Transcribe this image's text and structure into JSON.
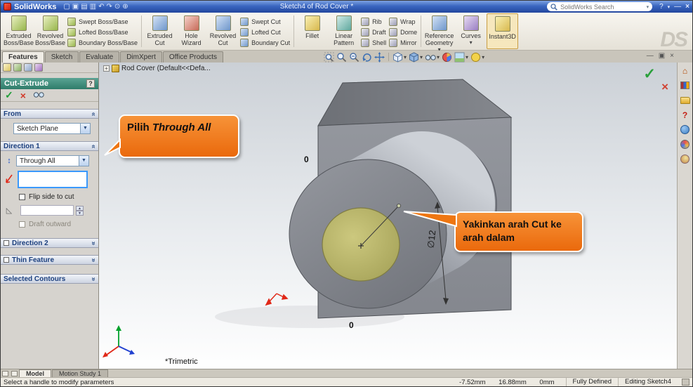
{
  "icons": {
    "new": "▢",
    "open": "▣",
    "save": "▤",
    "print": "▥",
    "undo": "↶",
    "redo": "↷",
    "rebuild": "⊙",
    "options": "⊕",
    "dropdown": "▾",
    "minimize": "—",
    "close": "×",
    "confirm": "✓",
    "cancel": "×",
    "select_arrow": "▼",
    "spin_up": "▲",
    "spin_down": "▼",
    "chevron": "«",
    "plus": "+"
  },
  "titlebar": {
    "app": "SolidWorks",
    "doc": "Sketch4 of Rod Cover *",
    "search_placeholder": "SolidWorks Search",
    "help": "?"
  },
  "ribbon": {
    "watermark": "DS",
    "g1": {
      "large": [
        {
          "label": "Extruded Boss/Base"
        },
        {
          "label": "Revolved Boss/Base"
        }
      ],
      "small": [
        {
          "label": "Swept Boss/Base"
        },
        {
          "label": "Lofted Boss/Base"
        },
        {
          "label": "Boundary Boss/Base"
        }
      ]
    },
    "g2": {
      "large": [
        {
          "label": "Extruded Cut"
        },
        {
          "label": "Hole Wizard"
        },
        {
          "label": "Revolved Cut"
        }
      ],
      "small": [
        {
          "label": "Swept Cut"
        },
        {
          "label": "Lofted Cut"
        },
        {
          "label": "Boundary Cut"
        }
      ]
    },
    "g3": {
      "large": [
        {
          "label": "Fillet"
        },
        {
          "label": "Linear Pattern"
        }
      ],
      "small": [
        {
          "label": "Rib"
        },
        {
          "label": "Draft"
        },
        {
          "label": "Shell"
        }
      ],
      "small2": [
        {
          "label": "Wrap"
        },
        {
          "label": "Dome"
        },
        {
          "label": "Mirror"
        }
      ]
    },
    "g4": {
      "large": [
        {
          "label": "Reference Geometry"
        },
        {
          "label": "Curves"
        },
        {
          "label": "Instant3D"
        }
      ]
    }
  },
  "tabs": [
    {
      "label": "Features"
    },
    {
      "label": "Sketch"
    },
    {
      "label": "Evaluate"
    },
    {
      "label": "DimXpert"
    },
    {
      "label": "Office Products"
    }
  ],
  "property_manager": {
    "title": "Cut-Extrude",
    "help": "?",
    "from": {
      "header": "From",
      "value": "Sketch Plane"
    },
    "direction1": {
      "header": "Direction 1",
      "end_condition": "Through All",
      "flip_label": "Flip side to cut",
      "draft_outward_label": "Draft outward"
    },
    "direction2": {
      "header": "Direction 2"
    },
    "thin_feature": {
      "header": "Thin Feature"
    },
    "selected_contours": {
      "header": "Selected Contours"
    }
  },
  "viewport": {
    "tree_node": "Rod Cover (Default<<Defa...",
    "view_orientation": "*Trimetric",
    "dimension": "∅12",
    "ordinate_zero_top": "0",
    "ordinate_zero_bottom": "0",
    "callout1": {
      "text": "Pilih ",
      "emphasis": "Through All"
    },
    "callout2": {
      "text": "Yakinkan arah Cut ke arah dalam"
    }
  },
  "bottom_tabs": [
    {
      "label": "Model"
    },
    {
      "label": "Motion Study 1"
    }
  ],
  "statusbar": {
    "message": "Select a handle to modify parameters",
    "x": "-7.52mm",
    "y": "16.88mm",
    "z": "0mm",
    "defined": "Fully Defined",
    "editing": "Editing Sketch4"
  },
  "colors": {
    "callout_orange": "#ee7612",
    "pm_header_teal": "#3d8f7e",
    "selection_blue": "#3b99fc",
    "highlight_yellow": "#e3e63e",
    "confirm_green": "#29a03a",
    "cancel_red": "#d04334",
    "titlebar_blue": "#3a66c0"
  }
}
